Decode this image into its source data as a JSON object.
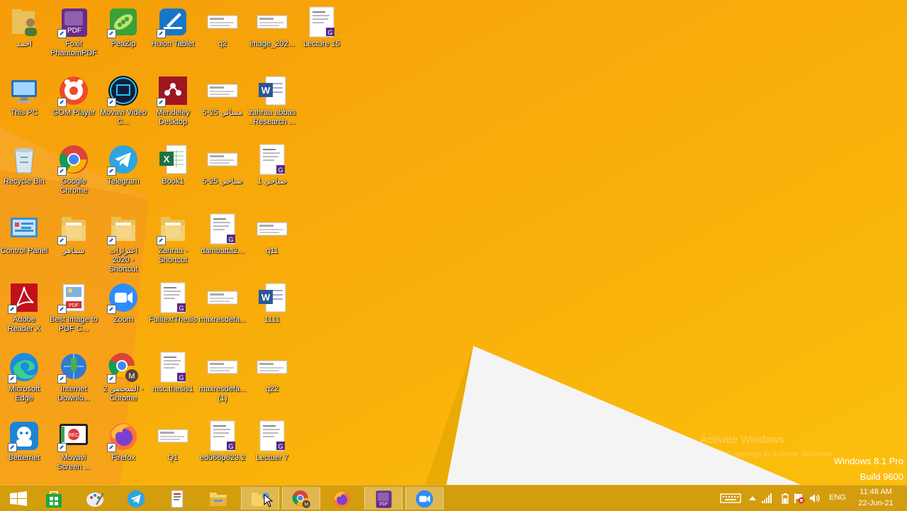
{
  "desktop_icons": [
    {
      "label": "احمد",
      "icon": "user-folder-icon"
    },
    {
      "label": "Foxit PhantomPDF",
      "icon": "foxit-pdf-icon"
    },
    {
      "label": "PeaZip",
      "icon": "peazip-icon"
    },
    {
      "label": "Huion Tablet",
      "icon": "huion-tablet-icon"
    },
    {
      "label": "q2",
      "icon": "image-thumbnail-icon"
    },
    {
      "label": "image_202...",
      "icon": "image-thumbnail-icon"
    },
    {
      "label": "Lecture 15",
      "icon": "pdf-document-icon"
    },
    {
      "label": "This PC",
      "icon": "this-pc-icon"
    },
    {
      "label": "GOM Player",
      "icon": "gom-player-icon"
    },
    {
      "label": "Movavi Video C...",
      "icon": "movavi-video-icon"
    },
    {
      "label": "Mendeley Desktop",
      "icon": "mendeley-icon"
    },
    {
      "label": "مسائي 25-5",
      "icon": "image-thumbnail-icon"
    },
    {
      "label": "zahraa abbas . Research ...",
      "icon": "word-document-icon"
    },
    {
      "label": "Recycle Bin",
      "icon": "recycle-bin-icon"
    },
    {
      "label": "Google Chrome",
      "icon": "chrome-icon"
    },
    {
      "label": "Telegram",
      "icon": "telegram-icon"
    },
    {
      "label": "Book1",
      "icon": "excel-document-icon"
    },
    {
      "label": "صباحي 25-5",
      "icon": "image-thumbnail-icon"
    },
    {
      "label": "صباحي 1",
      "icon": "pdf-document-icon"
    },
    {
      "label": "Control Panel",
      "icon": "control-panel-icon"
    },
    {
      "label": "سماهر",
      "icon": "folder-icon"
    },
    {
      "label": "اعتزازات 2020 - Shortcut",
      "icon": "folder-icon"
    },
    {
      "label": "Zahraa - Shortcut",
      "icon": "folder-icon"
    },
    {
      "label": "dambatta2...",
      "icon": "pdf-document-icon"
    },
    {
      "label": "q11",
      "icon": "image-thumbnail-icon"
    },
    {
      "label": "Adobe Reader X",
      "icon": "adobe-reader-icon"
    },
    {
      "label": "Best Image to PDF C...",
      "icon": "image-to-pdf-icon"
    },
    {
      "label": "Zoom",
      "icon": "zoom-icon"
    },
    {
      "label": "FulltextThesis",
      "icon": "pdf-document-icon"
    },
    {
      "label": "maxresdefa...",
      "icon": "image-thumbnail-icon"
    },
    {
      "label": "1111",
      "icon": "word-document-icon"
    },
    {
      "label": "Microsoft Edge",
      "icon": "edge-icon"
    },
    {
      "label": "Internet Downlo...",
      "icon": "internet-download-manager-icon"
    },
    {
      "label": "السحصن 2 - Chrome",
      "icon": "chrome-profile-icon"
    },
    {
      "label": "msc.thesis1",
      "icon": "pdf-document-icon"
    },
    {
      "label": "maxresdefa... (1)",
      "icon": "image-thumbnail-icon"
    },
    {
      "label": "q22",
      "icon": "image-thumbnail-icon"
    },
    {
      "label": "Betternet",
      "icon": "betternet-icon"
    },
    {
      "label": "Movavi Screen ...",
      "icon": "movavi-screen-icon"
    },
    {
      "label": "Firefox",
      "icon": "firefox-icon"
    },
    {
      "label": "Q1",
      "icon": "image-thumbnail-icon"
    },
    {
      "label": "ed068p623.2",
      "icon": "pdf-document-icon"
    },
    {
      "label": "Lectuer 7",
      "icon": "pdf-document-icon"
    }
  ],
  "watermark": {
    "activate_title": "Activate Windows",
    "activate_sub": "Go to PC settings to activate Windows.",
    "edition": "Windows 8.1 Pro",
    "build": "Build 9600"
  },
  "taskbar": {
    "buttons": [
      {
        "icon": "windows-start-icon"
      },
      {
        "icon": "store-icon"
      },
      {
        "icon": "paint-icon"
      },
      {
        "icon": "telegram-icon"
      },
      {
        "icon": "document-app-icon"
      },
      {
        "icon": "file-explorer-icon"
      },
      {
        "icon": "sticky-folder-icon"
      },
      {
        "icon": "chrome-profile-icon"
      },
      {
        "icon": "firefox-icon"
      },
      {
        "icon": "foxit-pdf-icon"
      },
      {
        "icon": "zoom-icon"
      }
    ],
    "tray": {
      "language": "ENG",
      "time": "11:48 AM",
      "date": "22-Jun-21"
    }
  }
}
